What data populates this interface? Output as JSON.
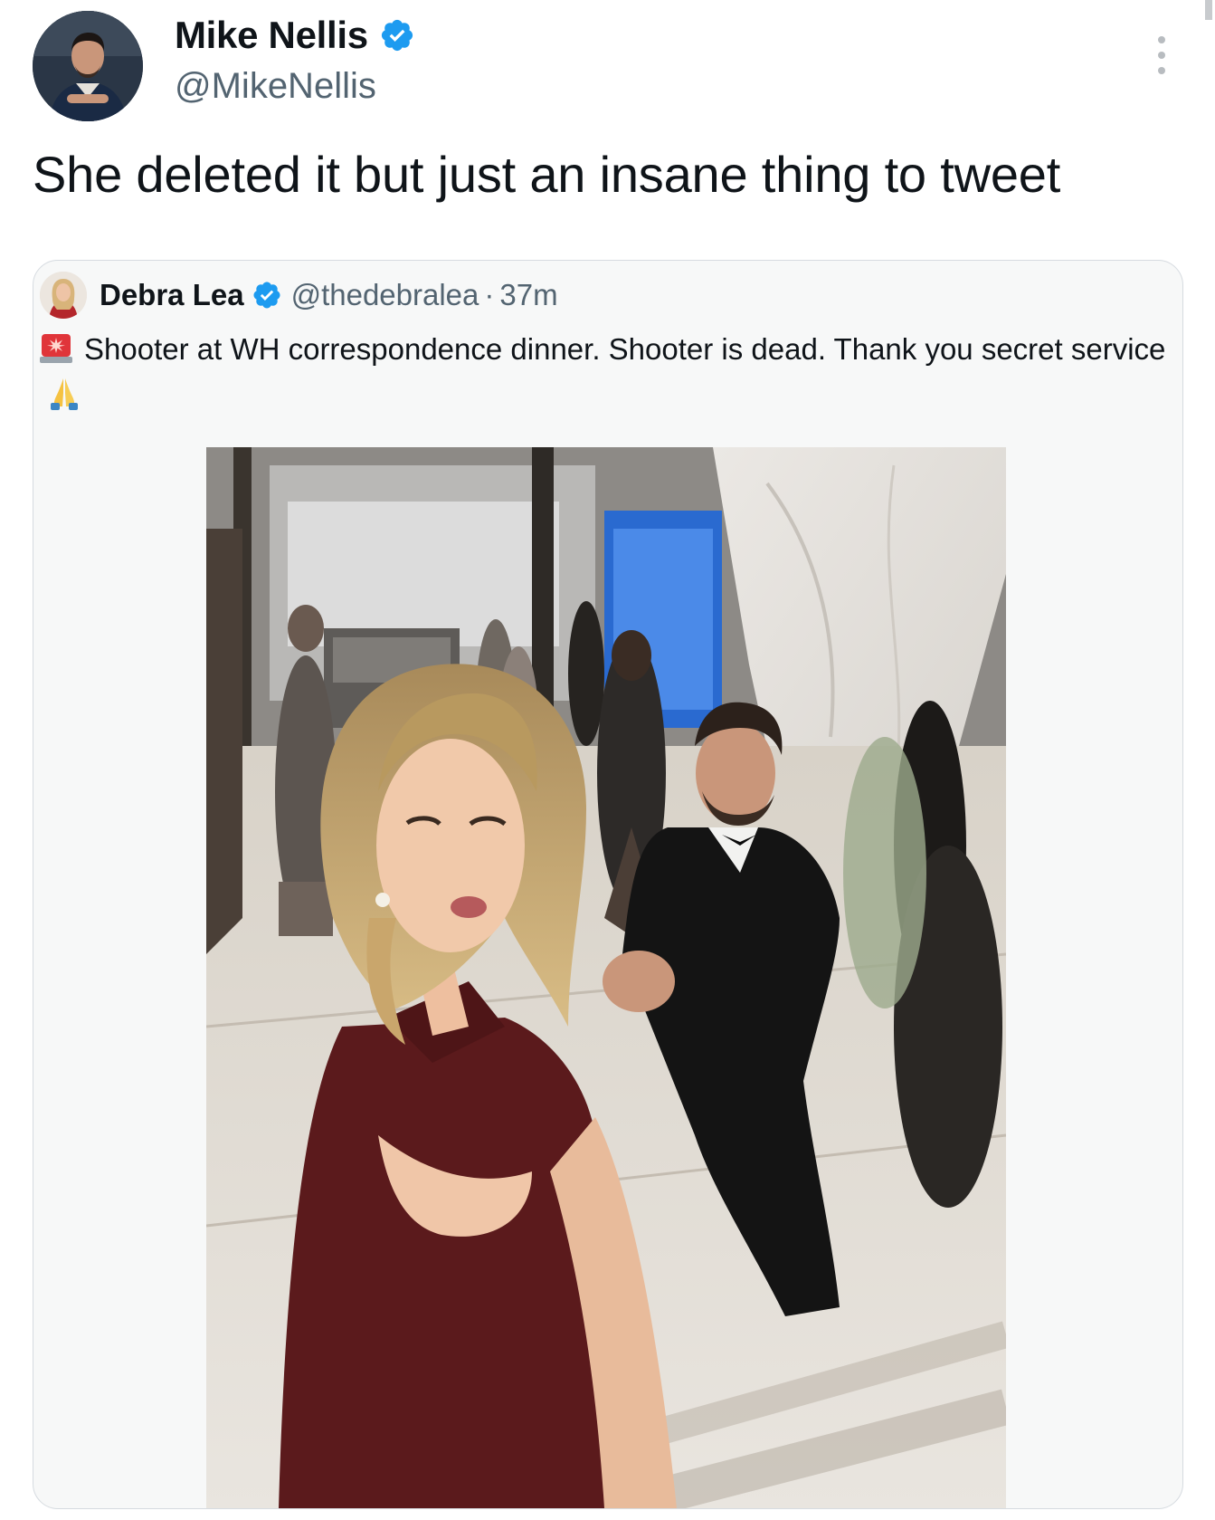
{
  "tweet": {
    "author": {
      "display_name": "Mike Nellis",
      "handle": "@MikeNellis",
      "verified": true,
      "avatar_icon": "profile-photo"
    },
    "text": "She deleted it but just an insane thing to tweet",
    "menu_icon": "more-options-icon"
  },
  "quoted_tweet": {
    "author": {
      "display_name": "Debra Lea",
      "handle": "@thedebralea",
      "verified": true,
      "avatar_icon": "profile-photo"
    },
    "separator": "·",
    "time": "37m",
    "text_leading_emoji": "siren-emoji-icon",
    "text": "Shooter at WH correspondence dinner. Shooter is dead. Thank you secret service",
    "text_trailing_emoji": "folded-hands-emoji-icon",
    "media": {
      "type": "photo",
      "icon": "selfie-photo"
    }
  },
  "colors": {
    "text_primary": "#0f1419",
    "text_secondary": "#536471",
    "verified_blue": "#1d9bf0",
    "card_border": "#d6dbe0",
    "card_background": "#f7f8f8"
  }
}
